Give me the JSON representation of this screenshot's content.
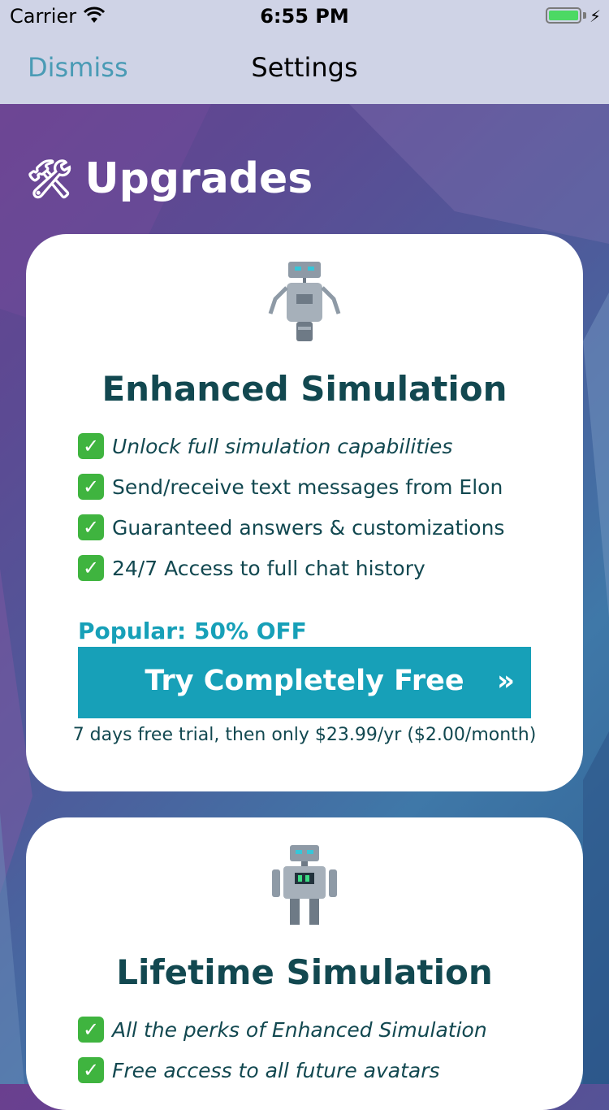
{
  "status_bar": {
    "carrier": "Carrier",
    "time": "6:55 PM",
    "battery_level": 1.0,
    "charging_icon": "bolt-icon"
  },
  "nav": {
    "dismiss_label": "Dismiss",
    "title": "Settings"
  },
  "section": {
    "icon": "🛠",
    "title": "Upgrades"
  },
  "cards": [
    {
      "title": "Enhanced Simulation",
      "robot_icon": "robot-icon",
      "features": [
        {
          "text": "Unlock full simulation capabilities",
          "italic": true
        },
        {
          "text": "Send/receive text messages from Elon",
          "italic": false
        },
        {
          "text": "Guaranteed answers & customizations",
          "italic": false
        },
        {
          "text": "24/7 Access to full chat history",
          "italic": false
        }
      ],
      "promo": "Popular: 50% OFF",
      "cta_label": "Try Completely Free",
      "cta_arrow": "»",
      "trial_text": "7 days free trial, then only $23.99/yr ($2.00/month)"
    },
    {
      "title": "Lifetime Simulation",
      "robot_icon": "robot-icon",
      "features": [
        {
          "text": "All the perks of Enhanced Simulation",
          "italic": true
        },
        {
          "text": "Free access to all future avatars",
          "italic": true
        }
      ]
    }
  ],
  "colors": {
    "accent": "#17a0b8",
    "title_text": "#124850",
    "dismiss": "#4a9bb5",
    "check": "#3fb43f"
  }
}
